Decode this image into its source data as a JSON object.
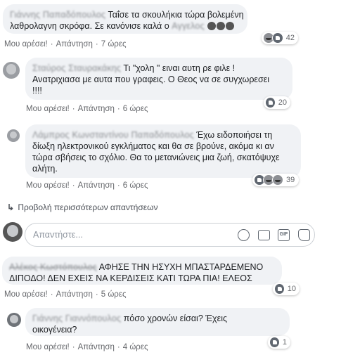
{
  "comments": [
    {
      "name": "Γιάννης Παπαδόπουλος",
      "text_l1": "Ταΐσε τα σκουλήκια τώρα βολεμένη",
      "text_l2": "λαθρολαγνη σκρόφα. Σε κανόνισε καλά ο",
      "mention": "Αγγελος",
      "like": "Μου αρέσει!",
      "reply": "Απάντηση",
      "time": "7 ώρες",
      "reactions": [
        "haha",
        "like"
      ],
      "count": "42"
    },
    {
      "name": "Σταύρος Σταυρακάκης",
      "text_l1": "Τι \"χολη \" ειναι αυτη ρε φιλε !",
      "text_l2": "Ανατριχιασα με αυτα που γραφεις. Ο Θεος να σε συγχωρεσει",
      "text_l3": "!!!!",
      "like": "Μου αρέσει!",
      "reply": "Απάντηση",
      "time": "6 ώρες",
      "reactions": [
        "like"
      ],
      "count": "20"
    },
    {
      "name": "Λάμπρος Κωνσταντίνου Παπαδόπουλος",
      "text_l1": "Έχω ειδοποιήσει τη",
      "text_l2": "δίωξη ηλεκτρονικού εγκλήματος και θα σε βρούνε, ακόμα κι αν",
      "text_l3": "τώρα σβήσεις το σχόλιο. Θα το μετανιώνεις μια ζωή, σκατόψυχε",
      "text_l4": "αλήτη.",
      "like": "Μου αρέσει!",
      "reply": "Απάντηση",
      "time": "6 ώρες",
      "reactions": [
        "like",
        "sad",
        "haha"
      ],
      "count": "39"
    },
    {
      "name": "Αλέκος Κωστόπουλος",
      "text_l1": "ΑΦΗΣΕ ΤΗΝ ΗΣΥΧΗ ΜΠΑΣΤΑΡΔΕΜΕΝΟ",
      "text_l2": "ΔΙΠΟΔΟ! ΔΕΝ ΕΧΕΙΣ ΝΑ ΚΕΡΔΙΣΕΙΣ ΚΑΤΙ ΤΩΡΑ ΠΙΑ! ΕΛΕΟΣ",
      "like": "Μου αρέσει!",
      "reply": "Απάντηση",
      "time": "5 ώρες",
      "reactions": [
        "like"
      ],
      "count": "10"
    },
    {
      "name": "Γιάννης Γιαννόπουλος",
      "text_l1": "πόσο χρονών είσαι? Έχεις",
      "text_l2": "οικογένεια?",
      "like": "Μου αρέσει!",
      "reply": "Απάντηση",
      "time": "4 ώρες",
      "reactions": [
        "like"
      ],
      "count": "1"
    }
  ],
  "more_replies": "Προβολή περισσότερων απαντήσεων",
  "reply_box": {
    "placeholder": "Απαντήστε...",
    "icons": [
      "smiley-icon",
      "camera-icon",
      "gif-icon",
      "sticker-icon"
    ]
  },
  "colors": {
    "bubble": "#f0f2f5",
    "meta_text": "#65676b"
  }
}
